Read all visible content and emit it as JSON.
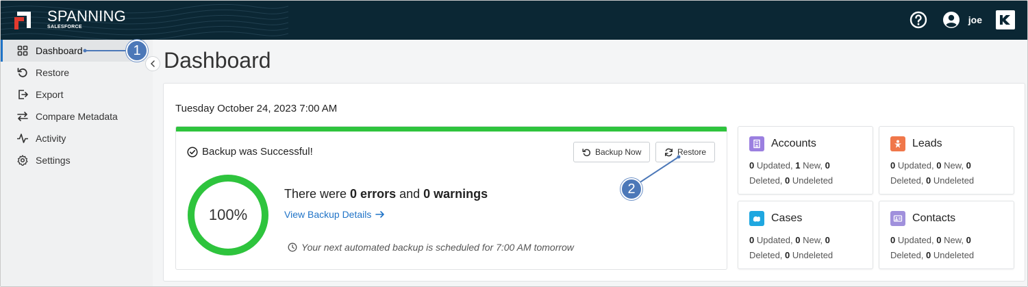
{
  "header": {
    "brand_name": "SPANNING",
    "brand_sub": "SALESFORCE",
    "user_name": "joe"
  },
  "sidebar": {
    "items": [
      {
        "label": "Dashboard",
        "icon": "grid-icon",
        "active": true
      },
      {
        "label": "Restore",
        "icon": "undo-icon"
      },
      {
        "label": "Export",
        "icon": "export-icon"
      },
      {
        "label": "Compare Metadata",
        "icon": "swap-arrows-icon"
      },
      {
        "label": "Activity",
        "icon": "pulse-icon"
      },
      {
        "label": "Settings",
        "icon": "gear-icon"
      }
    ]
  },
  "main": {
    "title": "Dashboard",
    "date": "Tuesday October 24, 2023 7:00 AM",
    "backup": {
      "status": "Backup was Successful!",
      "backup_now_label": "Backup Now",
      "restore_label": "Restore",
      "progress_percent": 100,
      "progress_label": "100%",
      "errors_prefix": "There were ",
      "errors_count": "0 errors",
      "errors_mid": " and ",
      "warnings_count": "0 warnings",
      "details_link": "View Backup Details",
      "schedule": "Your next automated backup is scheduled for 7:00 AM tomorrow"
    },
    "objects": [
      {
        "title": "Accounts",
        "icon": "accounts-icon",
        "color": "#9b7fe0",
        "updated": "0",
        "new": "1",
        "deleted": "0",
        "undeleted": "0"
      },
      {
        "title": "Leads",
        "icon": "leads-icon",
        "color": "#f0774a",
        "updated": "0",
        "new": "0",
        "deleted": "0",
        "undeleted": "0"
      },
      {
        "title": "Cases",
        "icon": "cases-icon",
        "color": "#1fa7e0",
        "updated": "0",
        "new": "0",
        "deleted": "0",
        "undeleted": "0"
      },
      {
        "title": "Contacts",
        "icon": "contacts-icon",
        "color": "#a090dc",
        "updated": "0",
        "new": "0",
        "deleted": "0",
        "undeleted": "0"
      }
    ],
    "stat_labels": {
      "updated": " Updated, ",
      "new": " New, ",
      "deleted": "Deleted, ",
      "undeleted": " Undeleted"
    }
  },
  "callouts": {
    "one": "1",
    "two": "2"
  },
  "colors": {
    "accent": "#1f73c7",
    "success": "#2ec43d",
    "header_bg": "#0b2734",
    "callout": "#4c78b8"
  }
}
